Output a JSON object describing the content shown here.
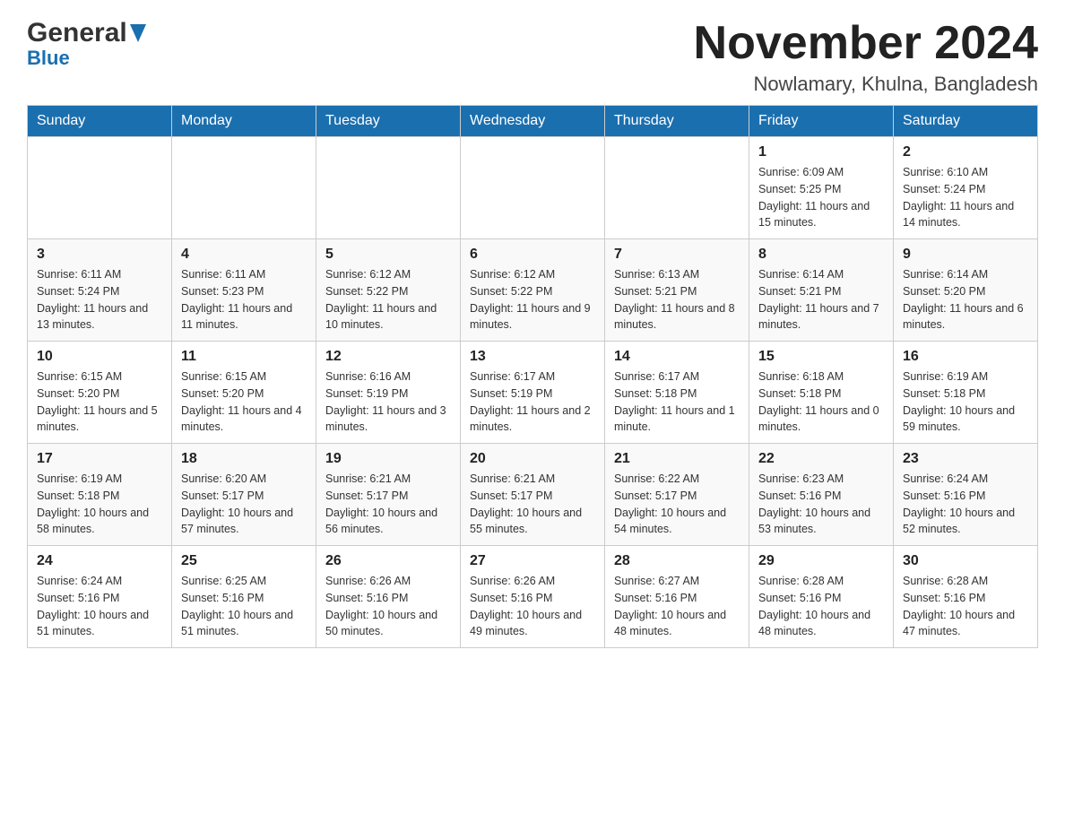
{
  "logo": {
    "general": "General",
    "blue": "Blue",
    "triangle_color": "#1a6faf"
  },
  "header": {
    "month_year": "November 2024",
    "location": "Nowlamary, Khulna, Bangladesh"
  },
  "days_of_week": [
    "Sunday",
    "Monday",
    "Tuesday",
    "Wednesday",
    "Thursday",
    "Friday",
    "Saturday"
  ],
  "weeks": [
    {
      "days": [
        {
          "num": "",
          "sunrise": "",
          "sunset": "",
          "daylight": ""
        },
        {
          "num": "",
          "sunrise": "",
          "sunset": "",
          "daylight": ""
        },
        {
          "num": "",
          "sunrise": "",
          "sunset": "",
          "daylight": ""
        },
        {
          "num": "",
          "sunrise": "",
          "sunset": "",
          "daylight": ""
        },
        {
          "num": "",
          "sunrise": "",
          "sunset": "",
          "daylight": ""
        },
        {
          "num": "1",
          "sunrise": "Sunrise: 6:09 AM",
          "sunset": "Sunset: 5:25 PM",
          "daylight": "Daylight: 11 hours and 15 minutes."
        },
        {
          "num": "2",
          "sunrise": "Sunrise: 6:10 AM",
          "sunset": "Sunset: 5:24 PM",
          "daylight": "Daylight: 11 hours and 14 minutes."
        }
      ]
    },
    {
      "days": [
        {
          "num": "3",
          "sunrise": "Sunrise: 6:11 AM",
          "sunset": "Sunset: 5:24 PM",
          "daylight": "Daylight: 11 hours and 13 minutes."
        },
        {
          "num": "4",
          "sunrise": "Sunrise: 6:11 AM",
          "sunset": "Sunset: 5:23 PM",
          "daylight": "Daylight: 11 hours and 11 minutes."
        },
        {
          "num": "5",
          "sunrise": "Sunrise: 6:12 AM",
          "sunset": "Sunset: 5:22 PM",
          "daylight": "Daylight: 11 hours and 10 minutes."
        },
        {
          "num": "6",
          "sunrise": "Sunrise: 6:12 AM",
          "sunset": "Sunset: 5:22 PM",
          "daylight": "Daylight: 11 hours and 9 minutes."
        },
        {
          "num": "7",
          "sunrise": "Sunrise: 6:13 AM",
          "sunset": "Sunset: 5:21 PM",
          "daylight": "Daylight: 11 hours and 8 minutes."
        },
        {
          "num": "8",
          "sunrise": "Sunrise: 6:14 AM",
          "sunset": "Sunset: 5:21 PM",
          "daylight": "Daylight: 11 hours and 7 minutes."
        },
        {
          "num": "9",
          "sunrise": "Sunrise: 6:14 AM",
          "sunset": "Sunset: 5:20 PM",
          "daylight": "Daylight: 11 hours and 6 minutes."
        }
      ]
    },
    {
      "days": [
        {
          "num": "10",
          "sunrise": "Sunrise: 6:15 AM",
          "sunset": "Sunset: 5:20 PM",
          "daylight": "Daylight: 11 hours and 5 minutes."
        },
        {
          "num": "11",
          "sunrise": "Sunrise: 6:15 AM",
          "sunset": "Sunset: 5:20 PM",
          "daylight": "Daylight: 11 hours and 4 minutes."
        },
        {
          "num": "12",
          "sunrise": "Sunrise: 6:16 AM",
          "sunset": "Sunset: 5:19 PM",
          "daylight": "Daylight: 11 hours and 3 minutes."
        },
        {
          "num": "13",
          "sunrise": "Sunrise: 6:17 AM",
          "sunset": "Sunset: 5:19 PM",
          "daylight": "Daylight: 11 hours and 2 minutes."
        },
        {
          "num": "14",
          "sunrise": "Sunrise: 6:17 AM",
          "sunset": "Sunset: 5:18 PM",
          "daylight": "Daylight: 11 hours and 1 minute."
        },
        {
          "num": "15",
          "sunrise": "Sunrise: 6:18 AM",
          "sunset": "Sunset: 5:18 PM",
          "daylight": "Daylight: 11 hours and 0 minutes."
        },
        {
          "num": "16",
          "sunrise": "Sunrise: 6:19 AM",
          "sunset": "Sunset: 5:18 PM",
          "daylight": "Daylight: 10 hours and 59 minutes."
        }
      ]
    },
    {
      "days": [
        {
          "num": "17",
          "sunrise": "Sunrise: 6:19 AM",
          "sunset": "Sunset: 5:18 PM",
          "daylight": "Daylight: 10 hours and 58 minutes."
        },
        {
          "num": "18",
          "sunrise": "Sunrise: 6:20 AM",
          "sunset": "Sunset: 5:17 PM",
          "daylight": "Daylight: 10 hours and 57 minutes."
        },
        {
          "num": "19",
          "sunrise": "Sunrise: 6:21 AM",
          "sunset": "Sunset: 5:17 PM",
          "daylight": "Daylight: 10 hours and 56 minutes."
        },
        {
          "num": "20",
          "sunrise": "Sunrise: 6:21 AM",
          "sunset": "Sunset: 5:17 PM",
          "daylight": "Daylight: 10 hours and 55 minutes."
        },
        {
          "num": "21",
          "sunrise": "Sunrise: 6:22 AM",
          "sunset": "Sunset: 5:17 PM",
          "daylight": "Daylight: 10 hours and 54 minutes."
        },
        {
          "num": "22",
          "sunrise": "Sunrise: 6:23 AM",
          "sunset": "Sunset: 5:16 PM",
          "daylight": "Daylight: 10 hours and 53 minutes."
        },
        {
          "num": "23",
          "sunrise": "Sunrise: 6:24 AM",
          "sunset": "Sunset: 5:16 PM",
          "daylight": "Daylight: 10 hours and 52 minutes."
        }
      ]
    },
    {
      "days": [
        {
          "num": "24",
          "sunrise": "Sunrise: 6:24 AM",
          "sunset": "Sunset: 5:16 PM",
          "daylight": "Daylight: 10 hours and 51 minutes."
        },
        {
          "num": "25",
          "sunrise": "Sunrise: 6:25 AM",
          "sunset": "Sunset: 5:16 PM",
          "daylight": "Daylight: 10 hours and 51 minutes."
        },
        {
          "num": "26",
          "sunrise": "Sunrise: 6:26 AM",
          "sunset": "Sunset: 5:16 PM",
          "daylight": "Daylight: 10 hours and 50 minutes."
        },
        {
          "num": "27",
          "sunrise": "Sunrise: 6:26 AM",
          "sunset": "Sunset: 5:16 PM",
          "daylight": "Daylight: 10 hours and 49 minutes."
        },
        {
          "num": "28",
          "sunrise": "Sunrise: 6:27 AM",
          "sunset": "Sunset: 5:16 PM",
          "daylight": "Daylight: 10 hours and 48 minutes."
        },
        {
          "num": "29",
          "sunrise": "Sunrise: 6:28 AM",
          "sunset": "Sunset: 5:16 PM",
          "daylight": "Daylight: 10 hours and 48 minutes."
        },
        {
          "num": "30",
          "sunrise": "Sunrise: 6:28 AM",
          "sunset": "Sunset: 5:16 PM",
          "daylight": "Daylight: 10 hours and 47 minutes."
        }
      ]
    }
  ]
}
